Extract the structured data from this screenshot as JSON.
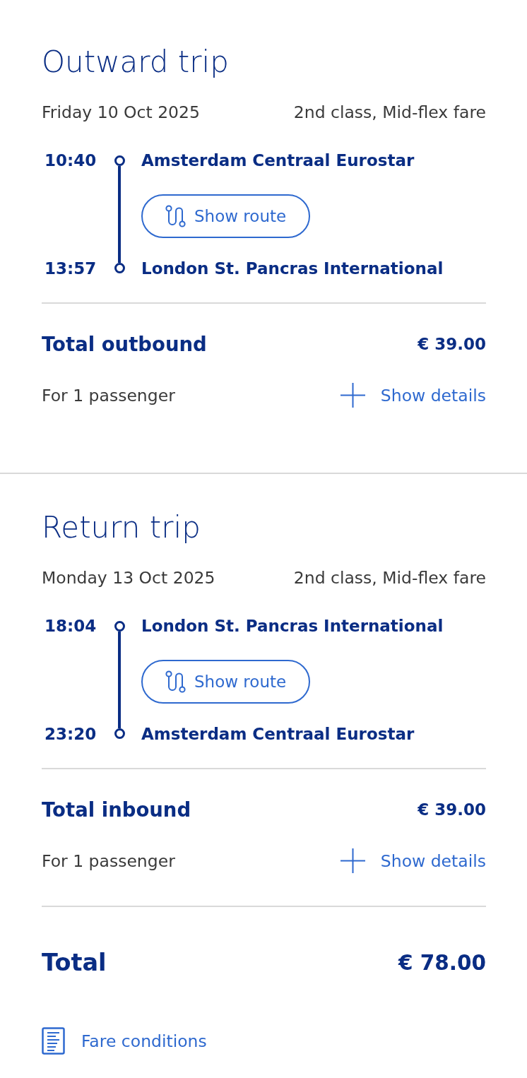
{
  "trips": [
    {
      "title": "Outward trip",
      "date": "Friday 10 Oct 2025",
      "fare": "2nd class, Mid-flex fare",
      "stops": [
        {
          "time": "10:40",
          "station": "Amsterdam Centraal Eurostar"
        },
        {
          "time": "13:57",
          "station": "London St. Pancras International"
        }
      ],
      "route_button": "Show route",
      "total_label": "Total outbound",
      "total_price": "€ 39.00",
      "passengers": "For 1 passenger",
      "details_link": "Show details"
    },
    {
      "title": "Return trip",
      "date": "Monday 13 Oct 2025",
      "fare": "2nd class, Mid-flex fare",
      "stops": [
        {
          "time": "18:04",
          "station": "London St. Pancras International"
        },
        {
          "time": "23:20",
          "station": "Amsterdam Centraal Eurostar"
        }
      ],
      "route_button": "Show route",
      "total_label": "Total inbound",
      "total_price": "€ 39.00",
      "passengers": "For 1 passenger",
      "details_link": "Show details"
    }
  ],
  "total": {
    "label": "Total",
    "price": "€ 78.00"
  },
  "fare_conditions_link": "Fare conditions"
}
